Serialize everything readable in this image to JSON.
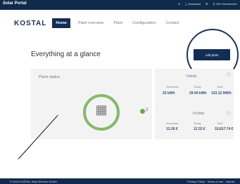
{
  "topbar": {
    "brand": "Solar Portal",
    "tools": [
      "∓",
      "Download",
      "⚙",
      "DIH Heimbucher"
    ]
  },
  "nav": {
    "logo": "KOSTAL",
    "items": [
      "Home",
      "Plant overview",
      "Plant",
      "Configuration",
      "Contact"
    ]
  },
  "main": {
    "title": "Everything at a glance",
    "add_button": "Add plant",
    "plant_status": {
      "title": "Plant status",
      "count": "2"
    },
    "yields": {
      "title": "Yields",
      "metrics": [
        "Yesterday",
        "Today",
        "Total"
      ],
      "values": [
        "33 kWh",
        "29.94 kWh",
        "133.12 MWh"
      ]
    },
    "profits": {
      "title": "Profits",
      "metrics": [
        "Yesterday",
        "Today",
        "Total"
      ],
      "values": [
        "13.26 €",
        "12.32 €",
        "19,817.74 €"
      ]
    }
  },
  "footer": {
    "left": "© 2024 KOSTAL Solar Electric GmbH",
    "right": "Privacy Policy · Terms of use · Imprint"
  },
  "colors": {
    "navy": "#0f2a4a",
    "accent": "#142d56",
    "green": "#86b86a"
  }
}
